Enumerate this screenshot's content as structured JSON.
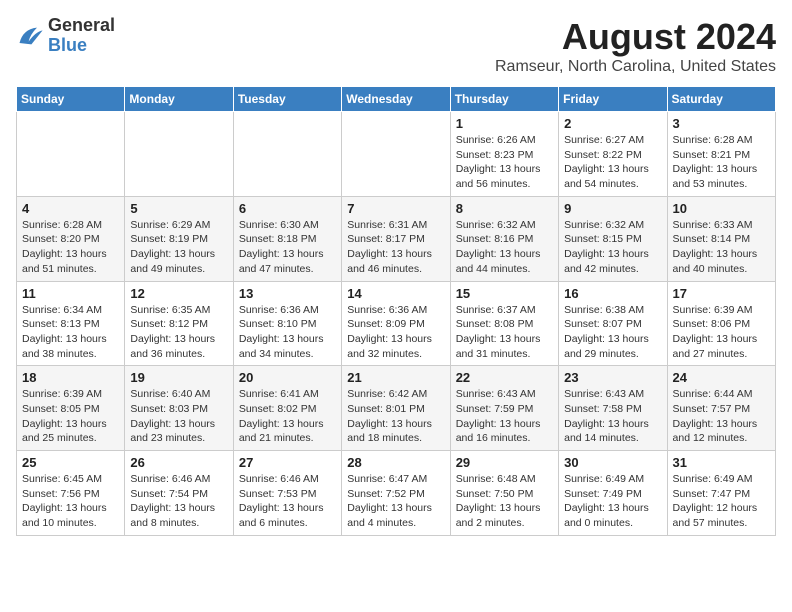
{
  "header": {
    "logo": {
      "line1": "General",
      "line2": "Blue"
    },
    "title": "August 2024",
    "subtitle": "Ramseur, North Carolina, United States"
  },
  "weekdays": [
    "Sunday",
    "Monday",
    "Tuesday",
    "Wednesday",
    "Thursday",
    "Friday",
    "Saturday"
  ],
  "weeks": [
    [
      {
        "day": "",
        "info": ""
      },
      {
        "day": "",
        "info": ""
      },
      {
        "day": "",
        "info": ""
      },
      {
        "day": "",
        "info": ""
      },
      {
        "day": "1",
        "info": "Sunrise: 6:26 AM\nSunset: 8:23 PM\nDaylight: 13 hours\nand 56 minutes."
      },
      {
        "day": "2",
        "info": "Sunrise: 6:27 AM\nSunset: 8:22 PM\nDaylight: 13 hours\nand 54 minutes."
      },
      {
        "day": "3",
        "info": "Sunrise: 6:28 AM\nSunset: 8:21 PM\nDaylight: 13 hours\nand 53 minutes."
      }
    ],
    [
      {
        "day": "4",
        "info": "Sunrise: 6:28 AM\nSunset: 8:20 PM\nDaylight: 13 hours\nand 51 minutes."
      },
      {
        "day": "5",
        "info": "Sunrise: 6:29 AM\nSunset: 8:19 PM\nDaylight: 13 hours\nand 49 minutes."
      },
      {
        "day": "6",
        "info": "Sunrise: 6:30 AM\nSunset: 8:18 PM\nDaylight: 13 hours\nand 47 minutes."
      },
      {
        "day": "7",
        "info": "Sunrise: 6:31 AM\nSunset: 8:17 PM\nDaylight: 13 hours\nand 46 minutes."
      },
      {
        "day": "8",
        "info": "Sunrise: 6:32 AM\nSunset: 8:16 PM\nDaylight: 13 hours\nand 44 minutes."
      },
      {
        "day": "9",
        "info": "Sunrise: 6:32 AM\nSunset: 8:15 PM\nDaylight: 13 hours\nand 42 minutes."
      },
      {
        "day": "10",
        "info": "Sunrise: 6:33 AM\nSunset: 8:14 PM\nDaylight: 13 hours\nand 40 minutes."
      }
    ],
    [
      {
        "day": "11",
        "info": "Sunrise: 6:34 AM\nSunset: 8:13 PM\nDaylight: 13 hours\nand 38 minutes."
      },
      {
        "day": "12",
        "info": "Sunrise: 6:35 AM\nSunset: 8:12 PM\nDaylight: 13 hours\nand 36 minutes."
      },
      {
        "day": "13",
        "info": "Sunrise: 6:36 AM\nSunset: 8:10 PM\nDaylight: 13 hours\nand 34 minutes."
      },
      {
        "day": "14",
        "info": "Sunrise: 6:36 AM\nSunset: 8:09 PM\nDaylight: 13 hours\nand 32 minutes."
      },
      {
        "day": "15",
        "info": "Sunrise: 6:37 AM\nSunset: 8:08 PM\nDaylight: 13 hours\nand 31 minutes."
      },
      {
        "day": "16",
        "info": "Sunrise: 6:38 AM\nSunset: 8:07 PM\nDaylight: 13 hours\nand 29 minutes."
      },
      {
        "day": "17",
        "info": "Sunrise: 6:39 AM\nSunset: 8:06 PM\nDaylight: 13 hours\nand 27 minutes."
      }
    ],
    [
      {
        "day": "18",
        "info": "Sunrise: 6:39 AM\nSunset: 8:05 PM\nDaylight: 13 hours\nand 25 minutes."
      },
      {
        "day": "19",
        "info": "Sunrise: 6:40 AM\nSunset: 8:03 PM\nDaylight: 13 hours\nand 23 minutes."
      },
      {
        "day": "20",
        "info": "Sunrise: 6:41 AM\nSunset: 8:02 PM\nDaylight: 13 hours\nand 21 minutes."
      },
      {
        "day": "21",
        "info": "Sunrise: 6:42 AM\nSunset: 8:01 PM\nDaylight: 13 hours\nand 18 minutes."
      },
      {
        "day": "22",
        "info": "Sunrise: 6:43 AM\nSunset: 7:59 PM\nDaylight: 13 hours\nand 16 minutes."
      },
      {
        "day": "23",
        "info": "Sunrise: 6:43 AM\nSunset: 7:58 PM\nDaylight: 13 hours\nand 14 minutes."
      },
      {
        "day": "24",
        "info": "Sunrise: 6:44 AM\nSunset: 7:57 PM\nDaylight: 13 hours\nand 12 minutes."
      }
    ],
    [
      {
        "day": "25",
        "info": "Sunrise: 6:45 AM\nSunset: 7:56 PM\nDaylight: 13 hours\nand 10 minutes."
      },
      {
        "day": "26",
        "info": "Sunrise: 6:46 AM\nSunset: 7:54 PM\nDaylight: 13 hours\nand 8 minutes."
      },
      {
        "day": "27",
        "info": "Sunrise: 6:46 AM\nSunset: 7:53 PM\nDaylight: 13 hours\nand 6 minutes."
      },
      {
        "day": "28",
        "info": "Sunrise: 6:47 AM\nSunset: 7:52 PM\nDaylight: 13 hours\nand 4 minutes."
      },
      {
        "day": "29",
        "info": "Sunrise: 6:48 AM\nSunset: 7:50 PM\nDaylight: 13 hours\nand 2 minutes."
      },
      {
        "day": "30",
        "info": "Sunrise: 6:49 AM\nSunset: 7:49 PM\nDaylight: 13 hours\nand 0 minutes."
      },
      {
        "day": "31",
        "info": "Sunrise: 6:49 AM\nSunset: 7:47 PM\nDaylight: 12 hours\nand 57 minutes."
      }
    ]
  ]
}
